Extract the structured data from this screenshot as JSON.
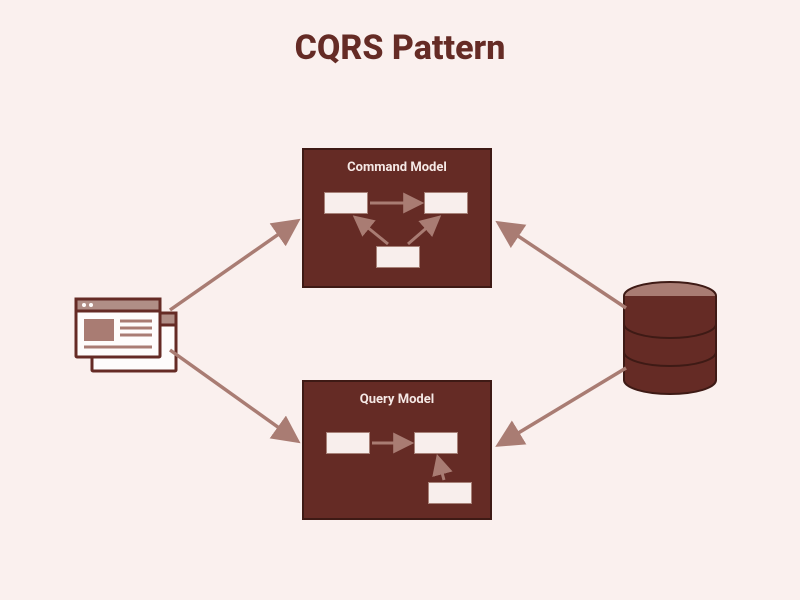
{
  "title": "CQRS Pattern",
  "nodes": {
    "client": {
      "name": "User Interface"
    },
    "command_model": {
      "label": "Command Model"
    },
    "query_model": {
      "label": "Query Model"
    },
    "database": {
      "name": "Database"
    }
  },
  "edges": [
    {
      "from": "client",
      "to": "command_model",
      "dir": "forward"
    },
    {
      "from": "client",
      "to": "query_model",
      "dir": "forward"
    },
    {
      "from": "database",
      "to": "command_model",
      "dir": "forward"
    },
    {
      "from": "database",
      "to": "query_model",
      "dir": "forward"
    }
  ],
  "colors": {
    "bg": "#faf0ee",
    "dark": "#652b25",
    "mid": "#a97c73",
    "light": "#f8eeec"
  }
}
